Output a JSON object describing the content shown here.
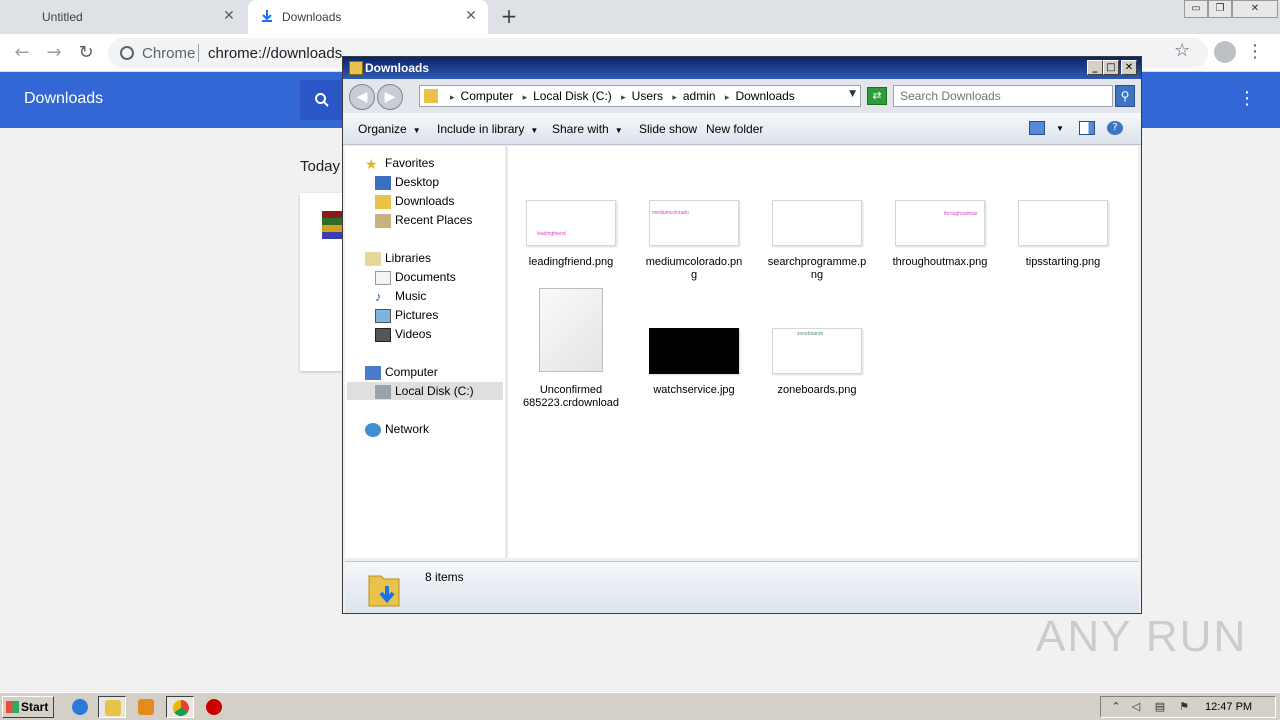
{
  "browser": {
    "tabs": [
      {
        "title": "Untitled",
        "active": false
      },
      {
        "title": "Downloads",
        "active": true
      }
    ],
    "omnibox": {
      "scheme_label": "Chrome",
      "url": "chrome://downloads"
    }
  },
  "downloads_page": {
    "title": "Downloads",
    "section": "Today"
  },
  "explorer": {
    "title": "Downloads",
    "breadcrumbs": [
      "Computer",
      "Local Disk (C:)",
      "Users",
      "admin",
      "Downloads"
    ],
    "search_placeholder": "Search Downloads",
    "commands": {
      "organize": "Organize",
      "include_in_library": "Include in library",
      "share_with": "Share with",
      "slide_show": "Slide show",
      "new_folder": "New folder"
    },
    "nav": {
      "favorites": "Favorites",
      "desktop": "Desktop",
      "downloads": "Downloads",
      "recent_places": "Recent Places",
      "libraries": "Libraries",
      "documents": "Documents",
      "music": "Music",
      "pictures": "Pictures",
      "videos": "Videos",
      "computer": "Computer",
      "local_disk": "Local Disk (C:)",
      "network": "Network"
    },
    "files": [
      {
        "name": "leadingfriend.png",
        "thumb_text": "leadingfriend"
      },
      {
        "name": "mediumcolorado.png",
        "thumb_text": "mediumcolorado"
      },
      {
        "name": "searchprogramme.png",
        "thumb_text": ""
      },
      {
        "name": "throughoutmax.png",
        "thumb_text": "throughoutmax"
      },
      {
        "name": "tipsstarting.png",
        "thumb_text": ""
      },
      {
        "name": "Unconfirmed 685223.crdownload",
        "thumb_text": ""
      },
      {
        "name": "watchservice.jpg",
        "thumb_text": ""
      },
      {
        "name": "zoneboards.png",
        "thumb_text": "zoneboards"
      }
    ],
    "status": "8 items"
  },
  "watermark": "ANY RUN",
  "taskbar": {
    "start_label": "Start",
    "clock": "12:47 PM"
  },
  "colors": {
    "chrome_header": "#3367d6",
    "explorer_title": "#0a246a",
    "thumb_text": "#e040c0"
  }
}
